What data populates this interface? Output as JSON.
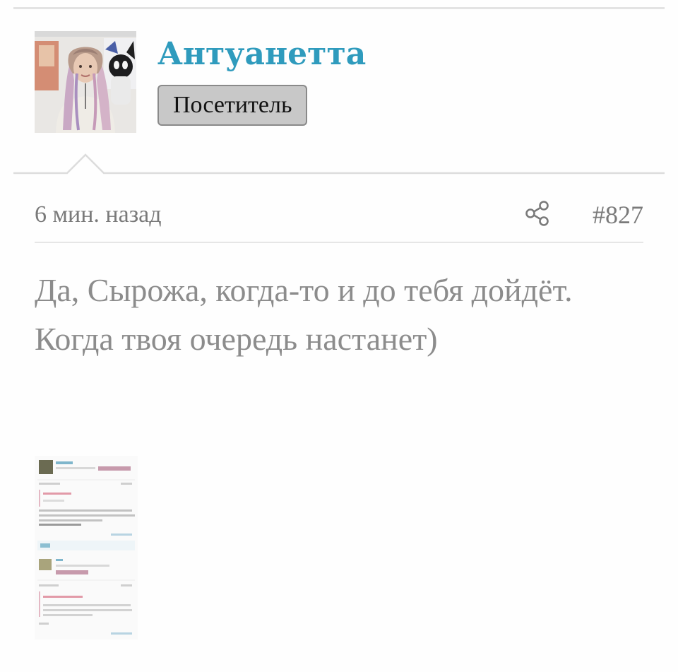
{
  "author": {
    "name": "Антуанетта",
    "role": "Посетитель",
    "avatar_icon": "user-avatar-photo"
  },
  "post": {
    "timestamp": "6 мин. назад",
    "share_icon": "share-icon",
    "number": "#827",
    "text": "Да, Сырожа, когда-то и до тебя дойдёт. Когда твоя очередь настанет)"
  },
  "attachment": {
    "kind": "screenshot-thumbnail"
  },
  "colors": {
    "author_name": "#2f9bbd",
    "badge_bg": "#c8c8c8",
    "meta_text": "#7a7a7a",
    "body_text": "#8c8c8c",
    "rules": "#e3e3e3"
  }
}
